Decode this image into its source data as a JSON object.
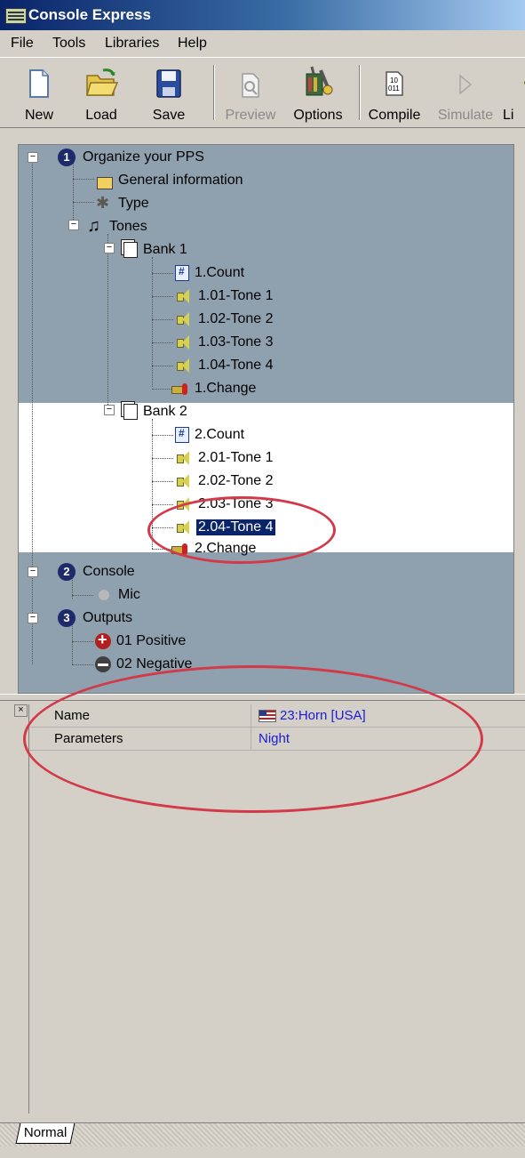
{
  "window": {
    "title": "Console Express"
  },
  "menu": [
    "File",
    "Tools",
    "Libraries",
    "Help"
  ],
  "toolbar": [
    {
      "label": "New",
      "icon": "new-document-icon",
      "enabled": true
    },
    {
      "label": "Load",
      "icon": "open-folder-icon",
      "enabled": true
    },
    {
      "label": "Save",
      "icon": "floppy-disk-icon",
      "enabled": true
    },
    {
      "label": "Preview",
      "icon": "preview-icon",
      "enabled": false
    },
    {
      "label": "Options",
      "icon": "tools-icon",
      "enabled": true
    },
    {
      "label": "Compile",
      "icon": "binary-icon",
      "enabled": true
    },
    {
      "label": "Simulate",
      "icon": "play-icon",
      "enabled": false
    },
    {
      "label": "Li",
      "icon": "key-icon",
      "enabled": true
    }
  ],
  "tree": {
    "sections": [
      {
        "number": "1",
        "label": "Organize your PPS"
      },
      {
        "number": "2",
        "label": "Console"
      },
      {
        "number": "3",
        "label": "Outputs"
      }
    ],
    "general_info": "General  information",
    "type": "Type",
    "tones": "Tones",
    "bank1": {
      "label": "Bank 1",
      "count": "1.Count",
      "tones": [
        "1.01-Tone 1",
        "1.02-Tone 2",
        "1.03-Tone 3",
        "1.04-Tone 4"
      ],
      "change": "1.Change"
    },
    "bank2": {
      "label": "Bank 2",
      "count": "2.Count",
      "tones": [
        "2.01-Tone 1",
        "2.02-Tone 2",
        "2.03-Tone 3",
        "2.04-Tone 4"
      ],
      "change": "2.Change",
      "selected": "2.04-Tone 4"
    },
    "mic": "Mic",
    "outputs": [
      "01 Positive",
      "02 Negative"
    ]
  },
  "properties": [
    {
      "name": "Name",
      "value": "23:Horn [USA]",
      "icon": "usa-flag-icon"
    },
    {
      "name": "Parameters",
      "value": "Night"
    }
  ],
  "status_tab": "Normal",
  "colors": {
    "selection": "#0a246a",
    "band": "#8fa0ae",
    "annotation": "#d23a4a",
    "value_text": "#1a1ad6"
  }
}
